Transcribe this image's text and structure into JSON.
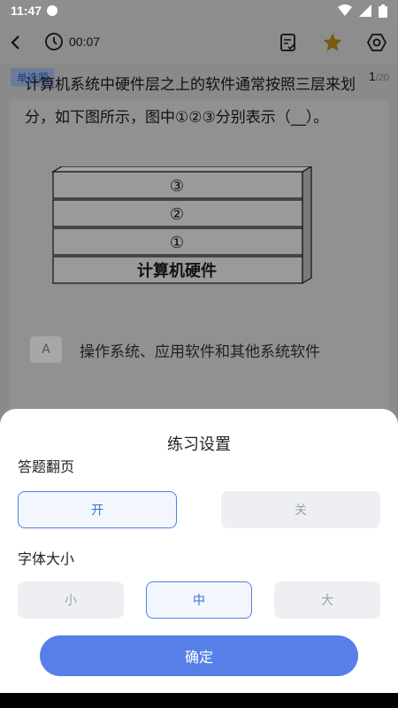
{
  "status_bar": {
    "time": "11:47"
  },
  "header": {
    "timer": "00:07"
  },
  "question": {
    "type": "单选题",
    "index": "1",
    "total": "/20",
    "text": "计算机系统中硬件层之上的软件通常按照三层来划分，如下图所示，图中①②③分别表示（__）。",
    "figure_layers": [
      "③",
      "②",
      "①",
      "计算机硬件"
    ],
    "option_a_letter": "A",
    "option_a_text": "操作系统、应用软件和其他系统软件"
  },
  "settings_sheet": {
    "title": "练习设置",
    "page_turn_label": "答题翻页",
    "page_turn_options": [
      "开",
      "关"
    ],
    "page_turn_selected": "开",
    "font_size_label": "字体大小",
    "font_size_options": [
      "小",
      "中",
      "大"
    ],
    "font_size_selected": "中",
    "confirm_label": "确定"
  },
  "colors": {
    "accent": "#5680e8",
    "selected_border": "#4b83e0",
    "star": "#e0a000"
  }
}
